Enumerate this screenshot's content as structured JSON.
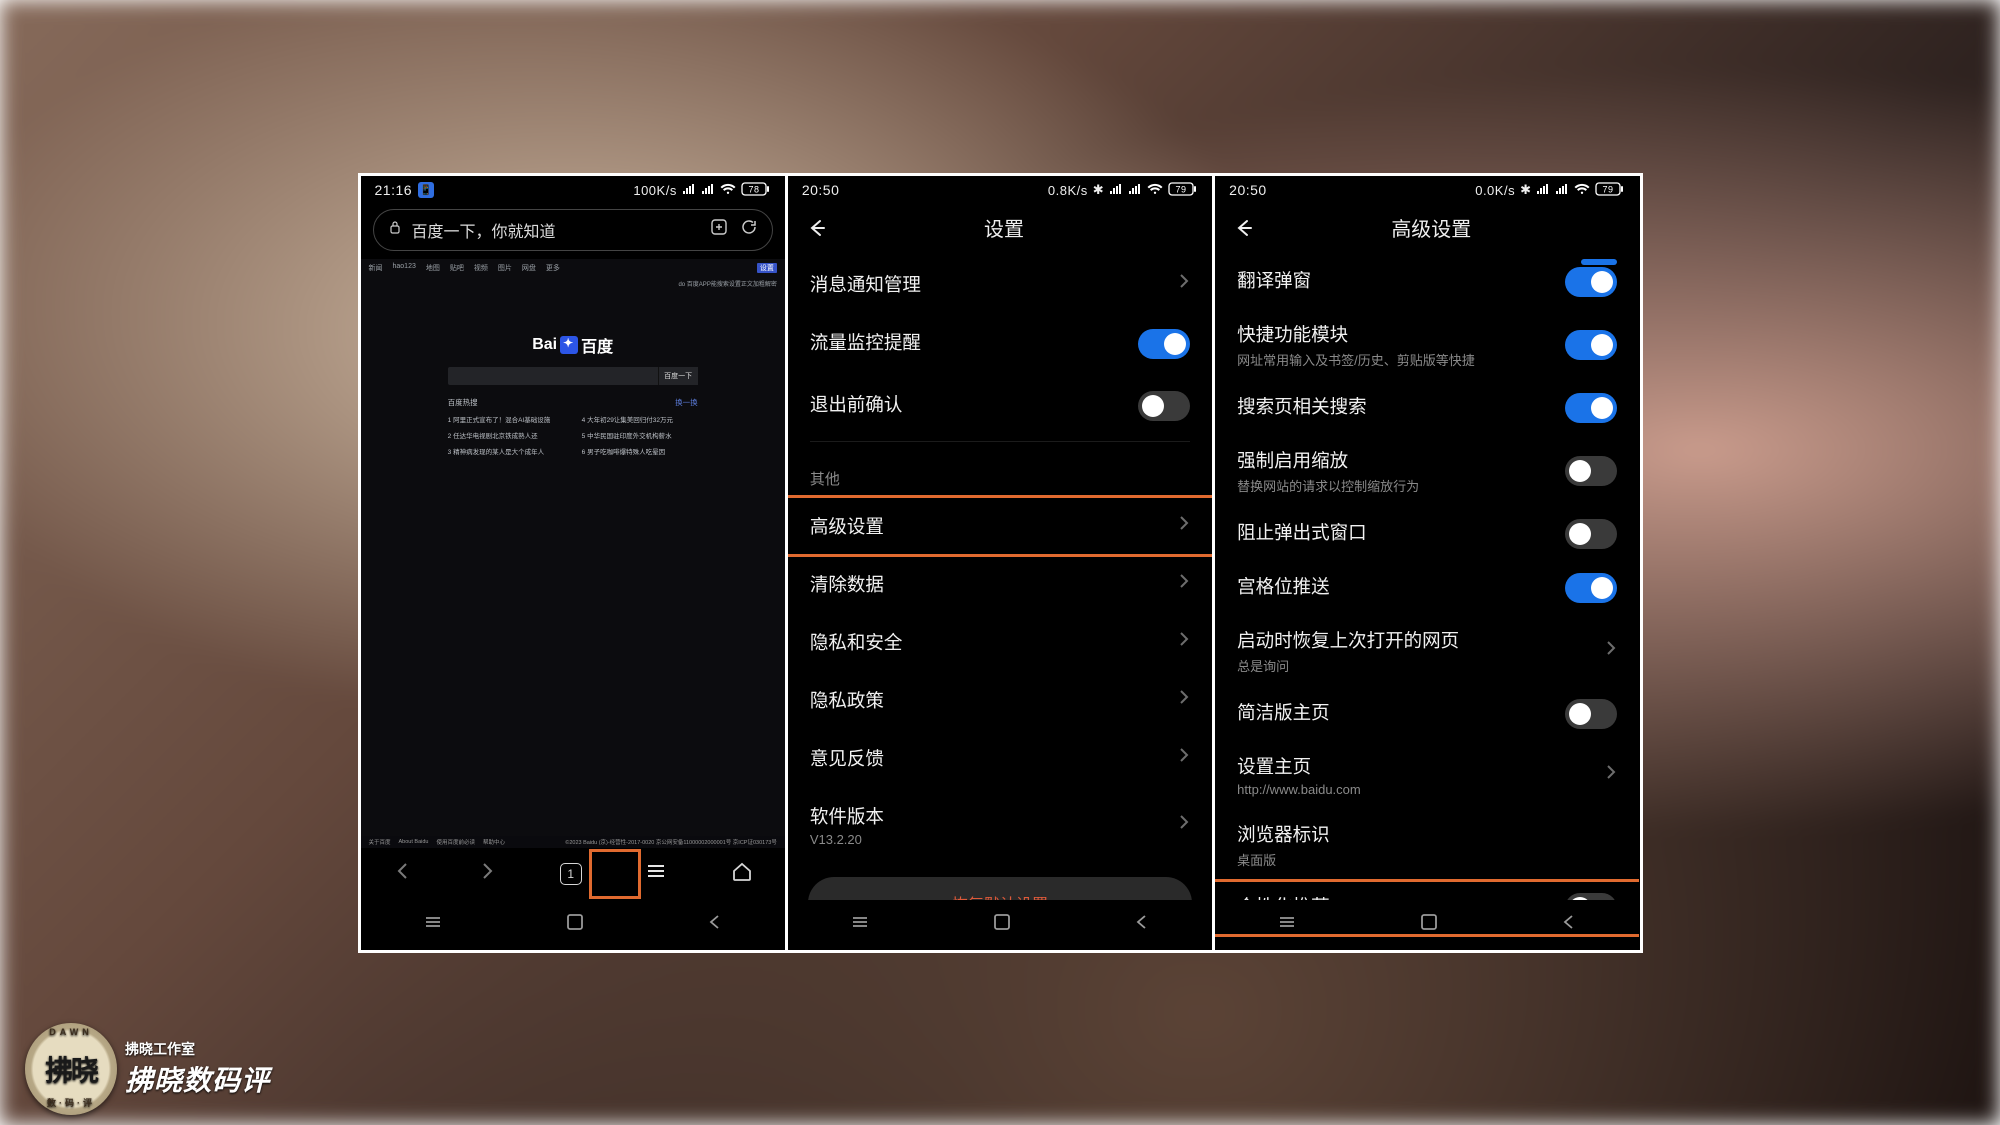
{
  "phone1": {
    "status": {
      "time": "21:16",
      "net": "100K/s",
      "batt": "78"
    },
    "addr": "百度一下，你就知道",
    "search_button": "百度一下",
    "hot_header": "百度热搜",
    "hot_more": "换一换",
    "hot": [
      "1  阿里正式宣布了！混合AI基础设施",
      "4  大年初29让集美回归付32万元",
      "2  任达华电视剧北京铁成熟人还",
      "5  中华民国驻印度外交机构薪水",
      "3  精神病发现的某人是大个成年人",
      "6  男子吃咖啡爆特殊人吃晕因"
    ],
    "tabs": "1"
  },
  "phone2": {
    "status": {
      "time": "20:50",
      "net": "0.8K/s",
      "batt": "79"
    },
    "title": "设置",
    "items": [
      {
        "label": "消息通知管理",
        "kind": "chev"
      },
      {
        "label": "流量监控提醒",
        "kind": "toggle",
        "on": true
      },
      {
        "label": "退出前确认",
        "kind": "toggle",
        "on": false
      }
    ],
    "group": "其他",
    "items2": [
      {
        "label": "高级设置",
        "kind": "chev",
        "hl": true
      },
      {
        "label": "清除数据",
        "kind": "chev"
      },
      {
        "label": "隐私和安全",
        "kind": "chev"
      },
      {
        "label": "隐私政策",
        "kind": "chev"
      },
      {
        "label": "意见反馈",
        "kind": "chev"
      },
      {
        "label": "软件版本",
        "sub": "V13.2.20",
        "kind": "chev"
      }
    ],
    "restore": "恢复默认设置"
  },
  "phone3": {
    "status": {
      "time": "20:50",
      "net": "0.0K/s",
      "batt": "79"
    },
    "title": "高级设置",
    "items": [
      {
        "label": "翻译弹窗",
        "kind": "toggle",
        "on": true
      },
      {
        "label": "快捷功能模块",
        "sub": "网址常用输入及书签/历史、剪贴版等快捷",
        "kind": "toggle",
        "on": true
      },
      {
        "label": "搜索页相关搜索",
        "kind": "toggle",
        "on": true
      },
      {
        "label": "强制启用缩放",
        "sub": "替换网站的请求以控制缩放行为",
        "kind": "toggle",
        "on": false
      },
      {
        "label": "阻止弹出式窗口",
        "kind": "toggle",
        "on": false
      },
      {
        "label": "宫格位推送",
        "kind": "toggle",
        "on": true
      },
      {
        "label": "启动时恢复上次打开的网页",
        "sub": "总是询问",
        "kind": "chev"
      },
      {
        "label": "简洁版主页",
        "kind": "toggle",
        "on": false
      },
      {
        "label": "设置主页",
        "sub": "http://www.baidu.com",
        "kind": "chev"
      },
      {
        "label": "浏览器标识",
        "sub": "桌面版",
        "kind": "chev-hidden"
      },
      {
        "label": "个性化推荐",
        "kind": "toggle",
        "on": false,
        "hl": true
      }
    ]
  },
  "watermark": {
    "studio": "拂晓工作室",
    "title": "拂晓数码评",
    "badge": "拂晓",
    "badge_top": "DAWN",
    "badge_bot": "数·码·评"
  }
}
